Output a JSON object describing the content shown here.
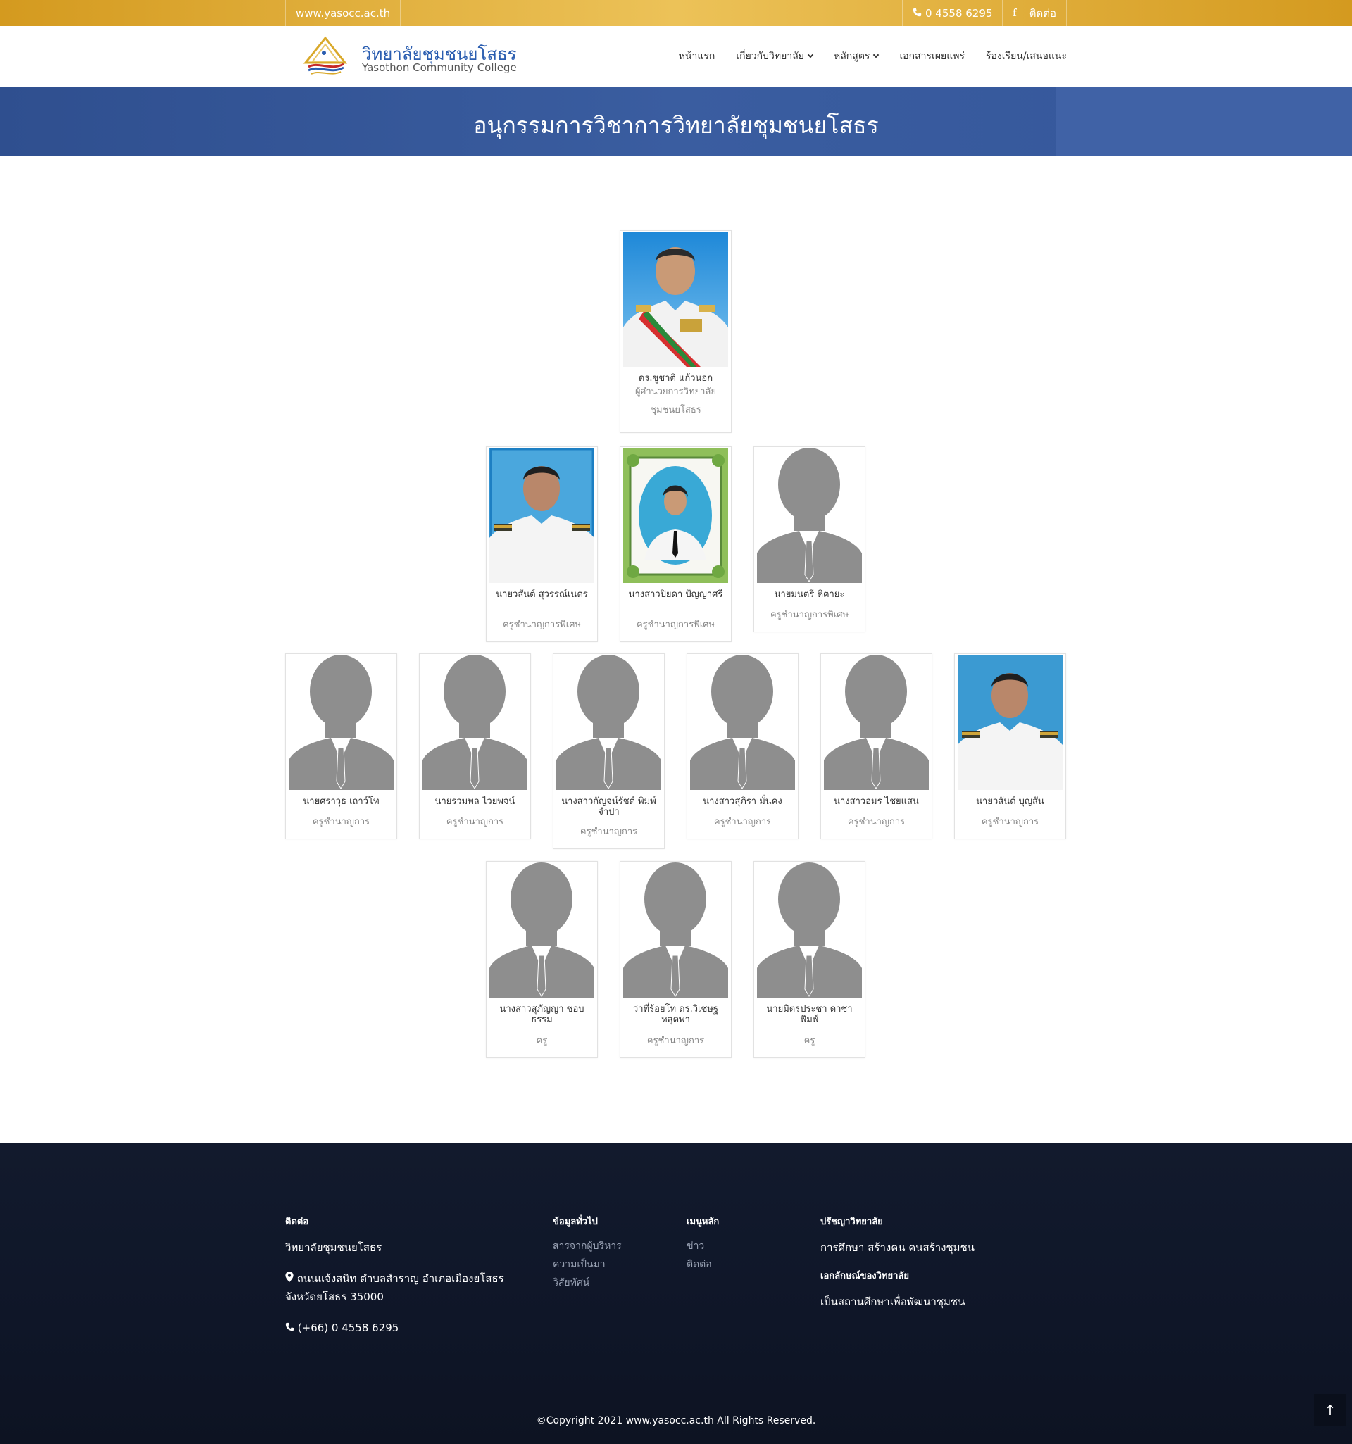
{
  "topbar": {
    "website": "www.yasocc.ac.th",
    "phone": "0 4558 6295",
    "contact": "ติดต่อ",
    "facebook_icon": "f"
  },
  "header": {
    "brand_th": "วิทยาลัยชุมชนยโสธร",
    "brand_en": "Yasothon Community College",
    "nav": [
      {
        "label": "หน้าแรก"
      },
      {
        "label": "เกี่ยวกับวิทยาลัย"
      },
      {
        "label": "หลักสูตร"
      },
      {
        "label": "เอกสารเผยแพร่"
      },
      {
        "label": "ร้องเรียน/เสนอแนะ"
      }
    ]
  },
  "banner": {
    "title": "อนุกรรมการวิชาการวิทยาลัยชุมชนยโสธร"
  },
  "members": [
    {
      "name": "ดร.ชูชาติ แก้วนอก",
      "role": "ผู้อำนวยการวิทยาลัยชุมชนยโสธร",
      "photo": "director"
    },
    {
      "name": "นายวสันต์ สุวรรณ์เนตร",
      "role": "ครูชำนาญการพิเศษ",
      "photo": "man-blue"
    },
    {
      "name": "นางสาวปิยดา ปัญญาศรี",
      "role": "ครูชำนาญการพิเศษ",
      "photo": "woman-frame"
    },
    {
      "name": "นายมนตรี หิตายะ",
      "role": "ครูชำนาญการพิเศษ",
      "photo": "placeholder"
    },
    {
      "name": "นายศราวุธ เถาว์โท",
      "role": "ครูชำนาญการ",
      "photo": "placeholder"
    },
    {
      "name": "นายรวมพล ไวยพจน์",
      "role": "ครูชำนาญการ",
      "photo": "placeholder"
    },
    {
      "name": "นางสาวกัญจน์รัชต์ พิมพ์จำปา",
      "role": "ครูชำนาญการ",
      "photo": "placeholder"
    },
    {
      "name": "นางสาวสุภิรา มั่นคง",
      "role": "ครูชำนาญการ",
      "photo": "placeholder"
    },
    {
      "name": "นางสาวอมร ไชยแสน",
      "role": "ครูชำนาญการ",
      "photo": "placeholder"
    },
    {
      "name": "นายวสันต์ บุญสัน",
      "role": "ครูชำนาญการ",
      "photo": "man-blue2"
    },
    {
      "name": "นางสาวสุภัญญา ชอบธรรม",
      "role": "ครู",
      "photo": "placeholder"
    },
    {
      "name": "ว่าที่ร้อยโท ดร.วิเชษฐ หลุดพา",
      "role": "ครูชำนาญการ",
      "photo": "placeholder"
    },
    {
      "name": "นายมิตรประชา ดาชาพิมพ์",
      "role": "ครู",
      "photo": "placeholder"
    }
  ],
  "footer": {
    "contact_head": "ติดต่อ",
    "college": "วิทยาลัยชุมชนยโสธร",
    "address_1": "ถนนแจ้งสนิท ตำบลสำราญ อำเภอเมืองยโสธร",
    "address_2": "จังหวัดยโสธร 35000",
    "phone": "(+66) 0 4558 6295",
    "general_head": "ข้อมูลทั่วไป",
    "general_links": [
      "สารจากผู้บริหาร",
      "ความเป็นมา",
      "วิสัยทัศน์"
    ],
    "menu_head": "เมนูหลัก",
    "menu_links": [
      "ข่าว",
      "ติดต่อ"
    ],
    "philosophy_head": "ปรัชญาวิทยาลัย",
    "philosophy": "การศึกษา สร้างคน คนสร้างชุมชน",
    "identity_head": "เอกลักษณ์ของวิทยาลัย",
    "identity": "เป็นสถานศึกษาเพื่อพัฒนาชุมชน",
    "copyright": "©Copyright 2021 www.yasocc.ac.th All Rights Reserved.",
    "totop_icon": "↑"
  },
  "colors": {
    "gold": "#e3b13f",
    "banner_blue": "#34569a",
    "brand_blue": "#2a5db0",
    "footer_dark": "#101729"
  }
}
